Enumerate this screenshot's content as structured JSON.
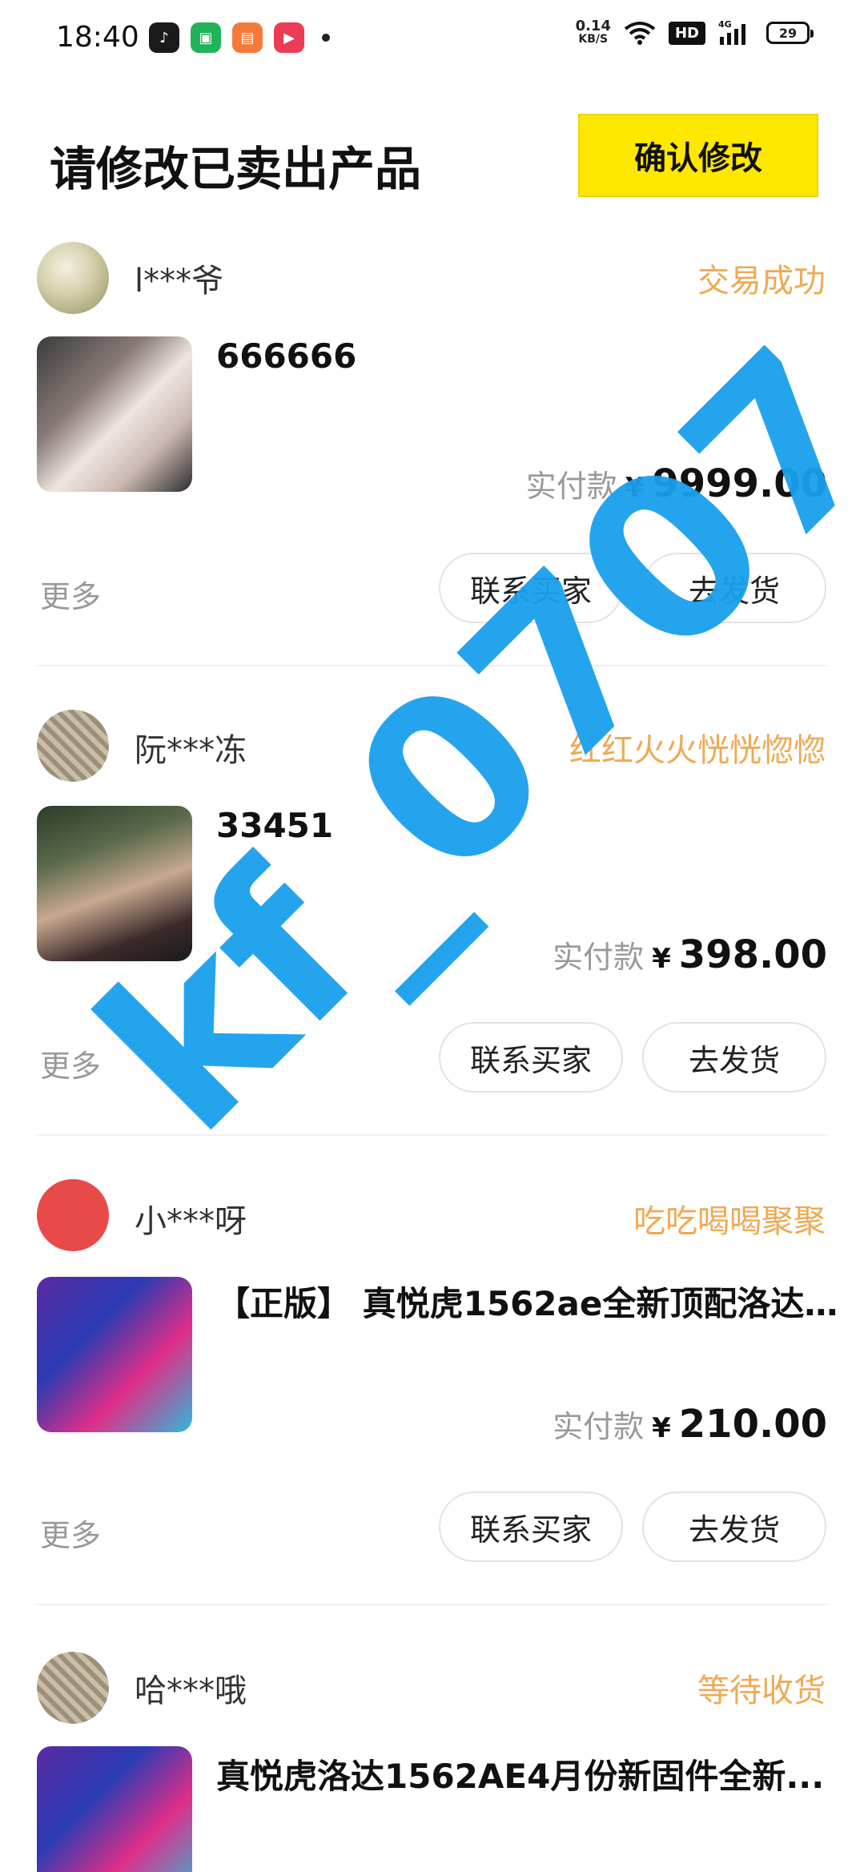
{
  "status_bar": {
    "time": "18:40",
    "net_speed_value": "0.14",
    "net_speed_unit": "KB/S",
    "hd": "HD",
    "network": "4G",
    "battery": "29"
  },
  "header": {
    "title": "请修改已卖出产品",
    "confirm_label": "确认修改"
  },
  "orders": [
    {
      "username": "l***爷",
      "status": "交易成功",
      "product_title": "666666",
      "price_label": "实付款",
      "currency": "¥",
      "price": "9999.00",
      "more_label": "更多",
      "contact_label": "联系买家",
      "ship_label": "去发货"
    },
    {
      "username": "阮***冻",
      "status": "红红火火恍恍惚惚",
      "product_title": "33451",
      "price_label": "实付款",
      "currency": "¥",
      "price": "398.00",
      "more_label": "更多",
      "contact_label": "联系买家",
      "ship_label": "去发货"
    },
    {
      "username": "小***呀",
      "status": "吃吃喝喝聚聚",
      "product_title": "【正版】 真悦虎1562ae全新顶配洛达...",
      "price_label": "实付款",
      "currency": "¥",
      "price": "210.00",
      "more_label": "更多",
      "contact_label": "联系买家",
      "ship_label": "去发货"
    },
    {
      "username": "哈***哦",
      "status": "等待收货",
      "product_title": "真悦虎洛达1562AE4月份新固件全新..."
    }
  ],
  "watermark": "kf_0707",
  "colors": {
    "accent_yellow": "#ffe800",
    "status_orange": "#efaa54",
    "watermark_blue": "#1aa0ee"
  }
}
